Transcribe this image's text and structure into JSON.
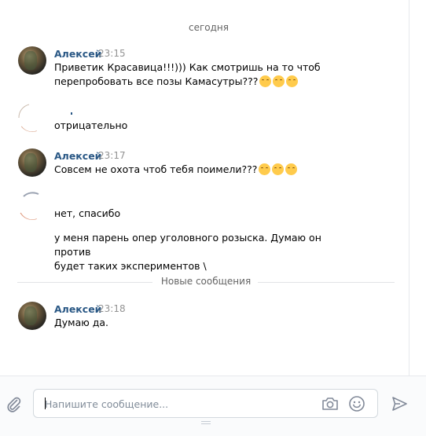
{
  "date_separator": "сегодня",
  "messages": [
    {
      "author": "Алексей",
      "time": "23:15",
      "lines": [
        "Приветик Красавица!!!))) Как смотришь на то чтоб",
        "перепробовать все позы Камасутры???"
      ],
      "emoji": [
        "face-with-rolling-eyes-icon",
        "face-with-rolling-eyes-icon",
        "face-with-rolling-eyes-icon"
      ]
    },
    {
      "author": "",
      "time": "",
      "lines": [
        "отрицательно"
      ]
    },
    {
      "author": "Алексей",
      "time": "23:17",
      "lines": [
        "Совсем не охота чтоб тебя поимели???"
      ],
      "emoji": [
        "face-with-rolling-eyes-icon",
        "face-with-rolling-eyes-icon",
        "face-with-rolling-eyes-icon"
      ]
    },
    {
      "author": "",
      "time": "",
      "lines": [
        "нет, спасибо"
      ]
    },
    {
      "author": "",
      "time": "",
      "lines": [
        "у меня парень опер уголовного розыска. Думаю он против",
        "будет таких экспериментов \\"
      ]
    }
  ],
  "new_messages_separator": "Новые сообщения",
  "new_messages": [
    {
      "author": "Алексей",
      "time": "23:18",
      "lines": [
        "Думаю да."
      ]
    }
  ],
  "composer": {
    "placeholder": "Напишите сообщение...",
    "attach_icon": "paperclip-icon",
    "camera_icon": "camera-icon",
    "emoji_icon": "smile-icon",
    "send_icon": "send-arrow-icon"
  },
  "colors": {
    "author_name": "#2a5885",
    "time": "#939393",
    "separator_text": "#656565",
    "icon": "#828a99"
  }
}
